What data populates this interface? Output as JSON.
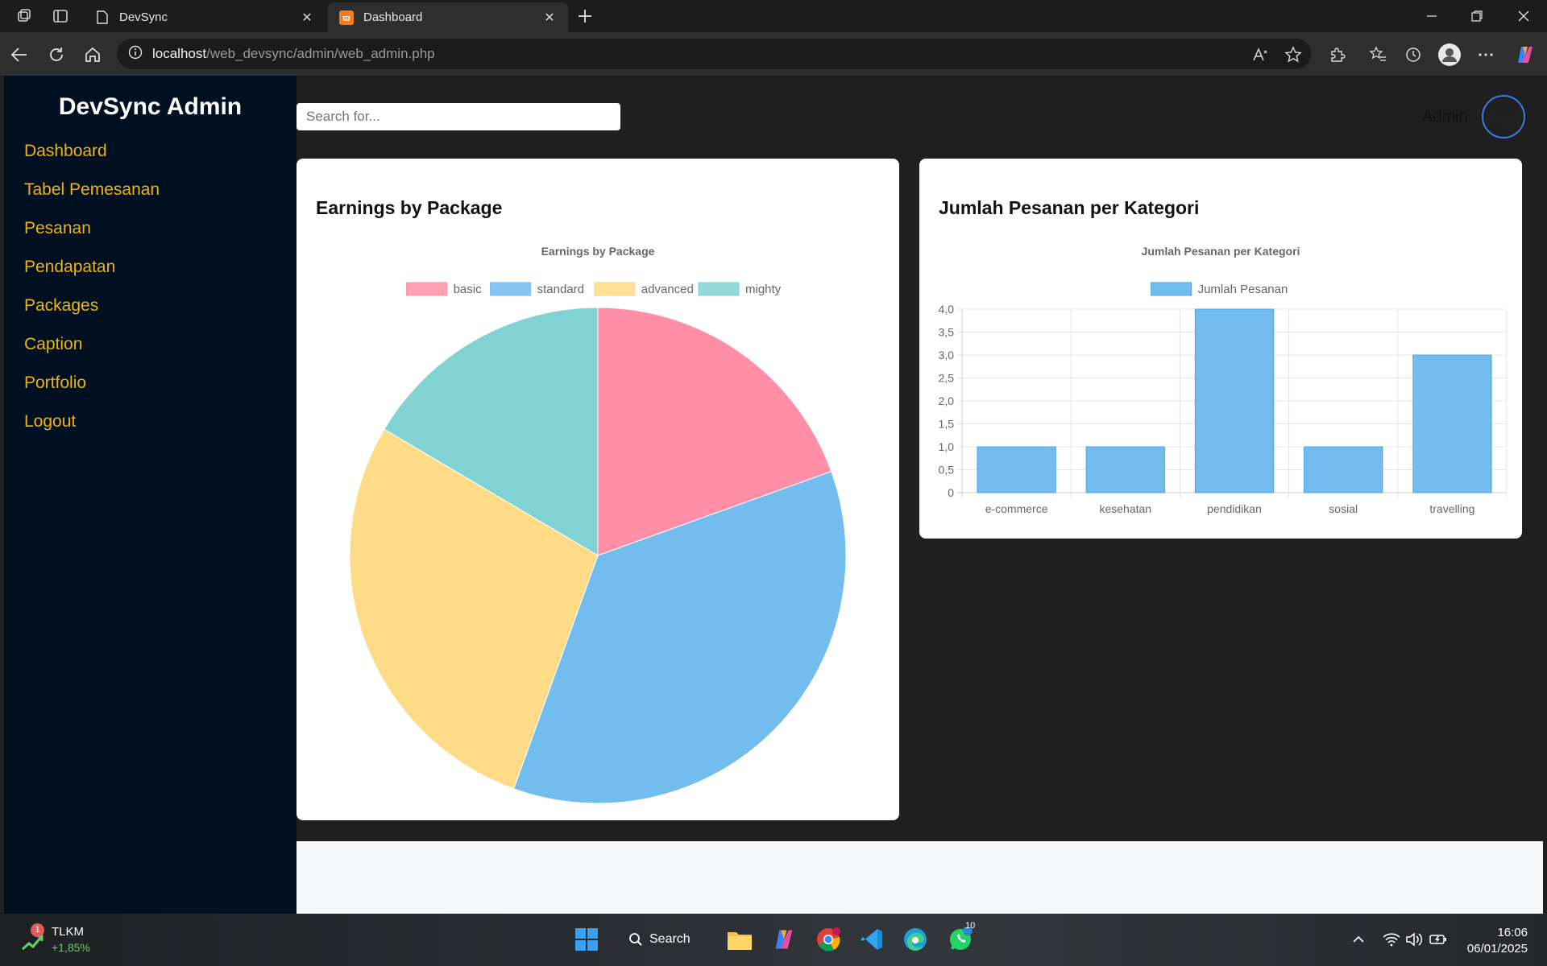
{
  "browser": {
    "tabs": [
      {
        "title": "DevSync",
        "active": false
      },
      {
        "title": "Dashboard",
        "active": true
      }
    ],
    "url_host": "localhost",
    "url_path": "/web_devsync/admin/web_admin.php"
  },
  "sidebar": {
    "brand": "DevSync Admin",
    "items": [
      {
        "label": "Dashboard"
      },
      {
        "label": "Tabel Pemesanan"
      },
      {
        "label": "Pesanan"
      },
      {
        "label": "Pendapatan"
      },
      {
        "label": "Packages"
      },
      {
        "label": "Caption"
      },
      {
        "label": "Portfolio"
      },
      {
        "label": "Logout"
      }
    ]
  },
  "topbar": {
    "search_placeholder": "Search for...",
    "user_name": "Admin",
    "avatar_alt": "Profil"
  },
  "colors": {
    "sidebar_bg": "#011020",
    "menu_text": "#f0b20e",
    "pie": [
      "#ff8fa6",
      "#72bcee",
      "#fedb87",
      "#81d3d3"
    ],
    "bar": "#72bcee"
  },
  "chart_data": [
    {
      "type": "pie",
      "card_title": "Earnings by Package",
      "title": "Earnings by Package",
      "legend_position": "top",
      "labels": [
        "basic",
        "standard",
        "advanced",
        "mighty"
      ],
      "values": [
        19.5,
        36,
        28,
        16.5
      ]
    },
    {
      "type": "bar",
      "card_title": "Jumlah Pesanan per Kategori",
      "title": "Jumlah Pesanan per Kategori",
      "legend_position": "top",
      "categories": [
        "e-commerce",
        "kesehatan",
        "pendidikan",
        "sosial",
        "travelling"
      ],
      "series": [
        {
          "name": "Jumlah Pesanan",
          "values": [
            1,
            1,
            4,
            1,
            3
          ]
        }
      ],
      "ylim": [
        0,
        4
      ],
      "ystep": 0.5,
      "ytick_labels": [
        "0",
        "0,5",
        "1,0",
        "1,5",
        "2,0",
        "2,5",
        "3,0",
        "3,5",
        "4,0"
      ],
      "grid": true
    }
  ],
  "taskbar": {
    "stock_symbol": "TLKM",
    "stock_change": "+1,85%",
    "stock_badge": "1",
    "search_label": "Search",
    "whatsapp_badge": "10",
    "time": "16:06",
    "date": "06/01/2025"
  }
}
